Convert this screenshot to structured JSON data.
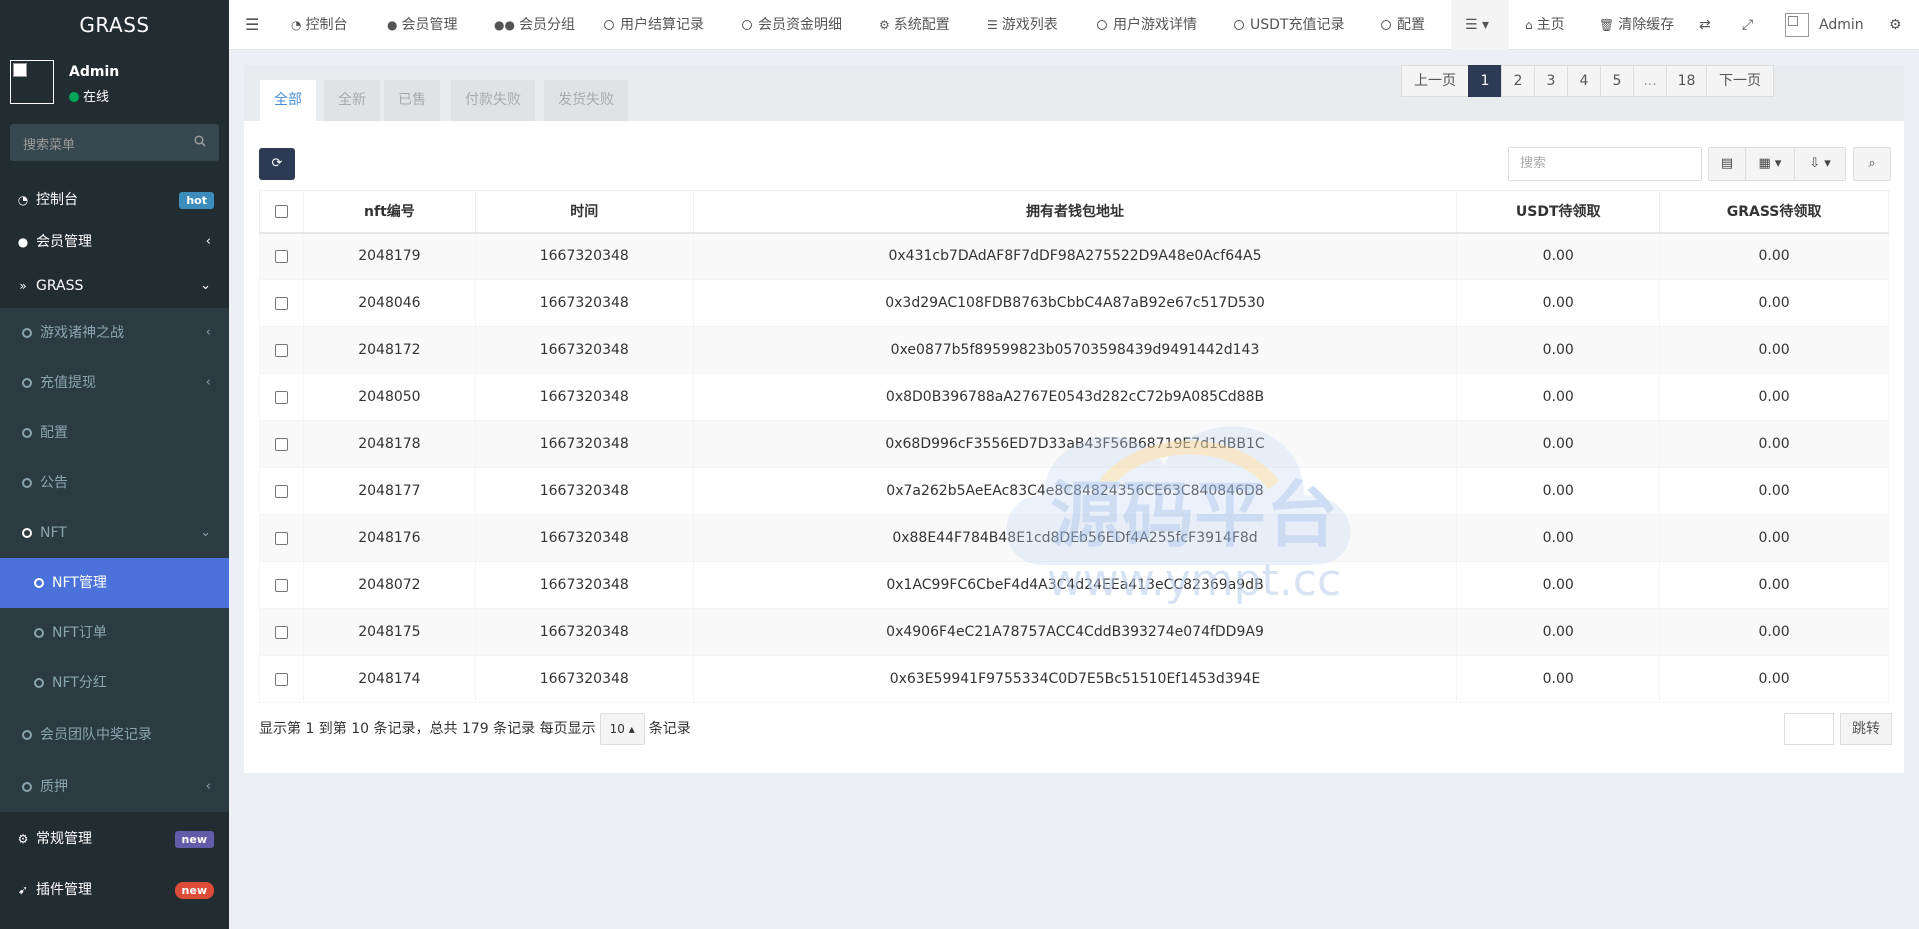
{
  "sidebar": {
    "logo": "GRASS",
    "user": {
      "name": "Admin",
      "status": "在线"
    },
    "search_placeholder": "搜索菜单",
    "items": [
      {
        "label": "控制台",
        "badge": "hot",
        "badge_color": "#3c8dbc"
      },
      {
        "label": "会员管理"
      },
      {
        "label": "GRASS"
      },
      {
        "label": "游戏诸神之战"
      },
      {
        "label": "充值提现"
      },
      {
        "label": "配置"
      },
      {
        "label": "公告"
      },
      {
        "label": "NFT"
      },
      {
        "label": "NFT管理"
      },
      {
        "label": "NFT订单"
      },
      {
        "label": "NFT分红"
      },
      {
        "label": "会员团队中奖记录"
      },
      {
        "label": "质押"
      },
      {
        "label": "常规管理",
        "badge": "new",
        "badge_color": "#605ca8"
      },
      {
        "label": "插件管理",
        "badge": "new",
        "badge_color": "#dd4b39"
      }
    ]
  },
  "topnav": {
    "items": [
      "控制台",
      "会员管理",
      "会员分组",
      "用户结算记录",
      "会员资金明细",
      "系统配置",
      "游戏列表",
      "用户游戏详情",
      "USDT充值记录",
      "配置"
    ],
    "home": "主页",
    "clear_cache": "清除缓存",
    "admin": "Admin"
  },
  "tabs": [
    "全部",
    "全新",
    "已售",
    "付款失败",
    "发货失败"
  ],
  "toolbar": {
    "search_placeholder": "搜索"
  },
  "table": {
    "columns": [
      "nft编号",
      "时间",
      "拥有者钱包地址",
      "USDT待领取",
      "GRASS待领取"
    ],
    "rows": [
      [
        "2048179",
        "1667320348",
        "0x431cb7DAdAF8F7dDF98A275522D9A48e0Acf64A5",
        "0.00",
        "0.00"
      ],
      [
        "2048046",
        "1667320348",
        "0x3d29AC108FDB8763bCbbC4A87aB92e67c517D530",
        "0.00",
        "0.00"
      ],
      [
        "2048172",
        "1667320348",
        "0xe0877b5f89599823b05703598439d9491442d143",
        "0.00",
        "0.00"
      ],
      [
        "2048050",
        "1667320348",
        "0x8D0B396788aA2767E0543d282cC72b9A085Cd88B",
        "0.00",
        "0.00"
      ],
      [
        "2048178",
        "1667320348",
        "0x68D996cF3556ED7D33aB43F56B68719E7d1dBB1C",
        "0.00",
        "0.00"
      ],
      [
        "2048177",
        "1667320348",
        "0x7a262b5AeEAc83C4e8C84824356CE63C840846D8",
        "0.00",
        "0.00"
      ],
      [
        "2048176",
        "1667320348",
        "0x88E44F784B48E1cd8DEb56EDf4A255fcF3914F8d",
        "0.00",
        "0.00"
      ],
      [
        "2048072",
        "1667320348",
        "0x1AC99FC6CbeF4d4A3C4d24EEa413eCC82369a9dB",
        "0.00",
        "0.00"
      ],
      [
        "2048175",
        "1667320348",
        "0x4906F4eC21A78757ACC4CddB393274e074fDD9A9",
        "0.00",
        "0.00"
      ],
      [
        "2048174",
        "1667320348",
        "0x63E59941F9755334C0D7E5Bc51510Ef1453d394E",
        "0.00",
        "0.00"
      ]
    ]
  },
  "pagination": {
    "info": "显示第 1 到第 10 条记录，总共 179 条记录 每页显示",
    "page_size": "10",
    "suffix": "条记录",
    "prev": "上一页",
    "pages": [
      "1",
      "2",
      "3",
      "4",
      "5",
      "...",
      "18"
    ],
    "next": "下一页",
    "jump": "跳转"
  },
  "watermark": {
    "title": "源码平台",
    "url": "www.ympt.cc"
  }
}
